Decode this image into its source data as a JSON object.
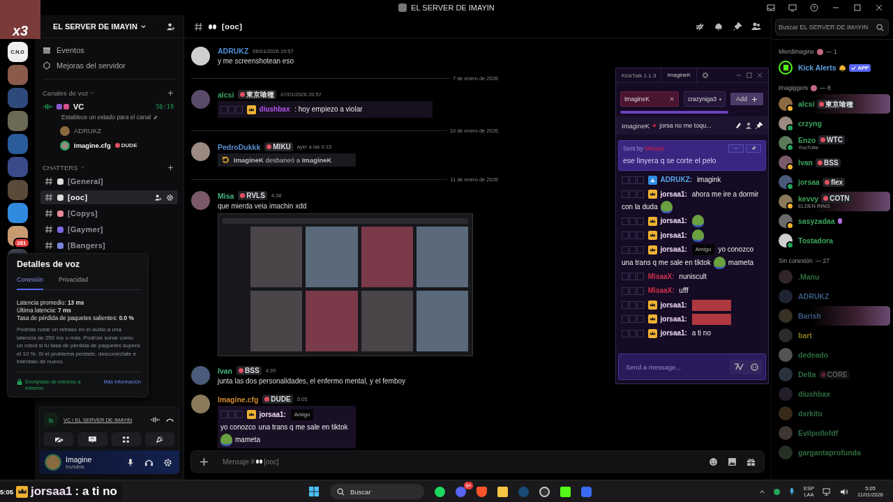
{
  "title_bar": {
    "title": "EL SERVER DE IMAYIN"
  },
  "webcam": {
    "caption": "x3"
  },
  "servers": {
    "logo_text": "C.N.O",
    "mention_badge": "281"
  },
  "sidebar": {
    "server_name": "EL SERVER DE IMAYIN",
    "links": [
      "Eventos",
      "Mejoras del servidor"
    ],
    "voice_category": "Canales de voz",
    "voice_channel": {
      "name": "VC",
      "timer": "56:19",
      "status": "Establece un estado para el canal",
      "users": [
        {
          "name": "ADRUKZ",
          "speaking": false
        },
        {
          "name": "Imagine.cfg",
          "speaking": true,
          "tag": "DUDE"
        }
      ]
    },
    "text_category": "CHATTERS",
    "channels": [
      {
        "name": "[General]",
        "selected": false
      },
      {
        "name": "[ooc]",
        "selected": true
      },
      {
        "name": "[Copys]",
        "selected": false
      },
      {
        "name": "[Gaymer]",
        "selected": false
      },
      {
        "name": "[Bangers]",
        "selected": false
      }
    ]
  },
  "voice_details": {
    "title": "Detalles de voz",
    "tabs": [
      {
        "label": "Conexión",
        "selected": true
      },
      {
        "label": "Privacidad",
        "selected": false
      }
    ],
    "stats": [
      "Latencia promedio: **13 ms**",
      "Última latencia: **7 ms**",
      "Tasa de pérdida de paquetes salientes: **0.0 %**"
    ],
    "note": "Podrías notar un retraso en el audio a una latencia de 250 ms o más. Podrías sonar como un robot si tu tasa de pérdida de paquetes supera el 10 %. Si el problema persiste, desconéctate e inténtalo de nuevo.",
    "encryption": "Encriptado de extremo a extremo",
    "more_link": "Más información"
  },
  "voice_panel": {
    "channel_link": "VC / EL SERVER DE IMAYIN"
  },
  "user_panel": {
    "name": "Imagine",
    "status": "Invisible"
  },
  "chat": {
    "channel": "[ooc]",
    "search_placeholder": "Buscar EL SERVER DE IMAYIN",
    "messages": [
      {
        "kind": "message",
        "author": "ADRUKZ",
        "color": "#4f8fd6",
        "time": "06/01/2026 19:57",
        "blocks": [
          {
            "kind": "text",
            "text": "y me screenshotean eso"
          }
        ]
      },
      {
        "kind": "divider",
        "label": "7 de enero de 2026"
      },
      {
        "kind": "message",
        "author": "alcsi",
        "color": "#3ba55d",
        "tag": "東京喰種",
        "time": "07/01/2026 20:57",
        "blocks": [
          {
            "kind": "kick",
            "line": {
              "user": "diushbax",
              "color": "#b455ee",
              "crown": true,
              "parts": [
                {
                  "kind": "text",
                  "text": ": hoy empiezo a violar"
                }
              ]
            }
          }
        ]
      },
      {
        "kind": "divider",
        "label": "10 de enero de 2026"
      },
      {
        "kind": "message",
        "author": "PedroDukkk",
        "color": "#5b8fd0",
        "tag": "MIKU",
        "time": "ayer a las 0:13",
        "blocks": [
          {
            "kind": "system",
            "text": "**ImagineK** desbaneó a **ImagineK**"
          }
        ]
      },
      {
        "kind": "divider",
        "label": "11 de enero de 2026"
      },
      {
        "kind": "message",
        "author": "Misa",
        "color": "#43b581",
        "tag": "RVLS",
        "time": "4:38",
        "blocks": [
          {
            "kind": "text",
            "text": "que mierda veia imachin xdd"
          },
          {
            "kind": "image"
          }
        ]
      },
      {
        "kind": "message",
        "author": "Ivan",
        "color": "#43b581",
        "tag": "BSS",
        "time": "4:39",
        "blocks": [
          {
            "kind": "text",
            "text": "junta las dos personalidades, el enfermo mental, y el femboy"
          }
        ]
      },
      {
        "kind": "message",
        "author": "Imagine.cfg",
        "color": "#d08a2e",
        "tag": "DUDE",
        "time": "5:05",
        "blocks": [
          {
            "kind": "kick",
            "line": {
              "user": "jorsaa1:",
              "color": "#f3dff7",
              "crown": true,
              "parts": [
                {
                  "kind": "sticker",
                  "text": "Amigo"
                },
                {
                  "kind": "text",
                  "text": "yo conozco"
                },
                {
                  "kind": "text",
                  "text": "una trans q me sale en tiktok"
                },
                {
                  "kind": "emote"
                },
                {
                  "kind": "text",
                  "text": "mameta"
                }
              ]
            }
          }
        ]
      }
    ],
    "composer": {
      "placeholder_start": "Mensaje #",
      "placeholder_end": "[ooc]"
    }
  },
  "kicktalk": {
    "app": "KickTalk 1.1.3",
    "tab": "ImagineK",
    "chats": [
      {
        "label": "ImagineK",
        "selected": true
      },
      {
        "label": "crazyniga3",
        "selected": false
      }
    ],
    "add": "Add",
    "live": {
      "channel": "ImagineK",
      "title": "jorsa no me toqu..."
    },
    "pinned": {
      "prefix": "Sent by",
      "author": "MisaaX",
      "text": "ese linyera q se corte el pelo"
    },
    "lines": [
      {
        "user": "ADRUKZ:",
        "color": "#58a6e8",
        "crown": false,
        "verified": true,
        "parts": [
          {
            "kind": "text",
            "text": "imagink"
          }
        ]
      },
      {
        "user": "jorsaa1:",
        "color": "#f3dff7",
        "crown": true,
        "parts": [
          {
            "kind": "text",
            "text": "ahora me ire a dormir"
          },
          {
            "kind": "text",
            "text": "con la duda"
          },
          {
            "kind": "emote"
          }
        ]
      },
      {
        "user": "jorsaa1:",
        "color": "#f3dff7",
        "crown": true,
        "parts": [
          {
            "kind": "emote"
          }
        ]
      },
      {
        "user": "jorsaa1:",
        "color": "#f3dff7",
        "crown": true,
        "parts": [
          {
            "kind": "emote"
          }
        ]
      },
      {
        "user": "jorsaa1:",
        "color": "#f3dff7",
        "crown": true,
        "parts": [
          {
            "kind": "sticker",
            "text": "Amigo"
          },
          {
            "kind": "text",
            "text": "yo conozco"
          },
          {
            "kind": "text",
            "text": "una trans q me sale en tiktok"
          },
          {
            "kind": "emote"
          },
          {
            "kind": "text",
            "text": "mameta"
          }
        ]
      },
      {
        "user": "MisaaX:",
        "color": "#d0304a",
        "crown": false,
        "parts": [
          {
            "kind": "text",
            "text": "nuniscult"
          }
        ]
      },
      {
        "user": "MisaaX:",
        "color": "#d0304a",
        "crown": false,
        "parts": [
          {
            "kind": "text",
            "text": "ufff"
          }
        ]
      },
      {
        "user": "jorsaa1:",
        "color": "#f3dff7",
        "crown": true,
        "parts": [
          {
            "kind": "image"
          }
        ]
      },
      {
        "user": "jorsaa1:",
        "color": "#f3dff7",
        "crown": true,
        "parts": [
          {
            "kind": "image"
          }
        ]
      },
      {
        "user": "jorsaa1:",
        "color": "#f3dff7",
        "crown": true,
        "parts": [
          {
            "kind": "text",
            "text": "a ti no"
          }
        ]
      }
    ],
    "input_placeholder": "Send a message..."
  },
  "members": {
    "groups": [
      {
        "name": "Mierdimagine",
        "count": "— 1",
        "online": true,
        "members": [
          {
            "name": "Kick Alerts",
            "color": "#5aa0e0",
            "app_badge": "APP"
          }
        ]
      },
      {
        "name": "Imagiggers",
        "count": "— 8",
        "online": true,
        "members": [
          {
            "name": "alcsi",
            "color": "#3ba55d",
            "idle": true,
            "tag": "東京喰種",
            "highlight": true
          },
          {
            "name": "crzyng",
            "color": "#3ba55d",
            "idle": false
          },
          {
            "name": "Enzo",
            "color": "#3ba55d",
            "idle": false,
            "tag": "WTC",
            "activity": "YouTube"
          },
          {
            "name": "Ivan",
            "color": "#3ba55d",
            "idle": true,
            "tag": "BSS"
          },
          {
            "name": "jorsaa",
            "color": "#3ba55d",
            "idle": false,
            "tag": "flex"
          },
          {
            "name": "kevvy",
            "color": "#3ba55d",
            "idle": true,
            "tag": "COTN",
            "activity": "ELDEN RING",
            "highlight": true
          },
          {
            "name": "sasyzadaa",
            "color": "#3ba55d",
            "idle": true,
            "boost": true
          },
          {
            "name": "Tostadora",
            "color": "#3ba55d",
            "idle": false
          }
        ]
      },
      {
        "name": "Sin conexión",
        "count": "— 27",
        "online": false,
        "members": [
          {
            "name": ".Manu",
            "color": "#2d6b3f"
          },
          {
            "name": "ADRUKZ",
            "color": "#3a5a80"
          },
          {
            "name": "Barish",
            "color": "#3a5a80",
            "highlight": true
          },
          {
            "name": "bart",
            "color": "#8a7a20"
          },
          {
            "name": "dedeado",
            "color": "#2d6b3f"
          },
          {
            "name": "Delta",
            "color": "#2d6b3f",
            "tag": "CORE"
          },
          {
            "name": "diushbax",
            "color": "#2d6b3f"
          },
          {
            "name": "dxrkito",
            "color": "#2d6b3f"
          },
          {
            "name": "Evilpollofdf",
            "color": "#2d6b3f"
          },
          {
            "name": "gargantaprofunda",
            "color": "#2d6b3f"
          }
        ]
      }
    ]
  },
  "taskbar": {
    "search_placeholder": "Buscar",
    "discord_badge": "9+",
    "language": "ESP",
    "layout": "LAA",
    "time": "5:05",
    "date": "11/01/2026"
  },
  "stream_overlay": {
    "time": "5:05",
    "user": "jorsaa1",
    "text": ": a ti no"
  }
}
